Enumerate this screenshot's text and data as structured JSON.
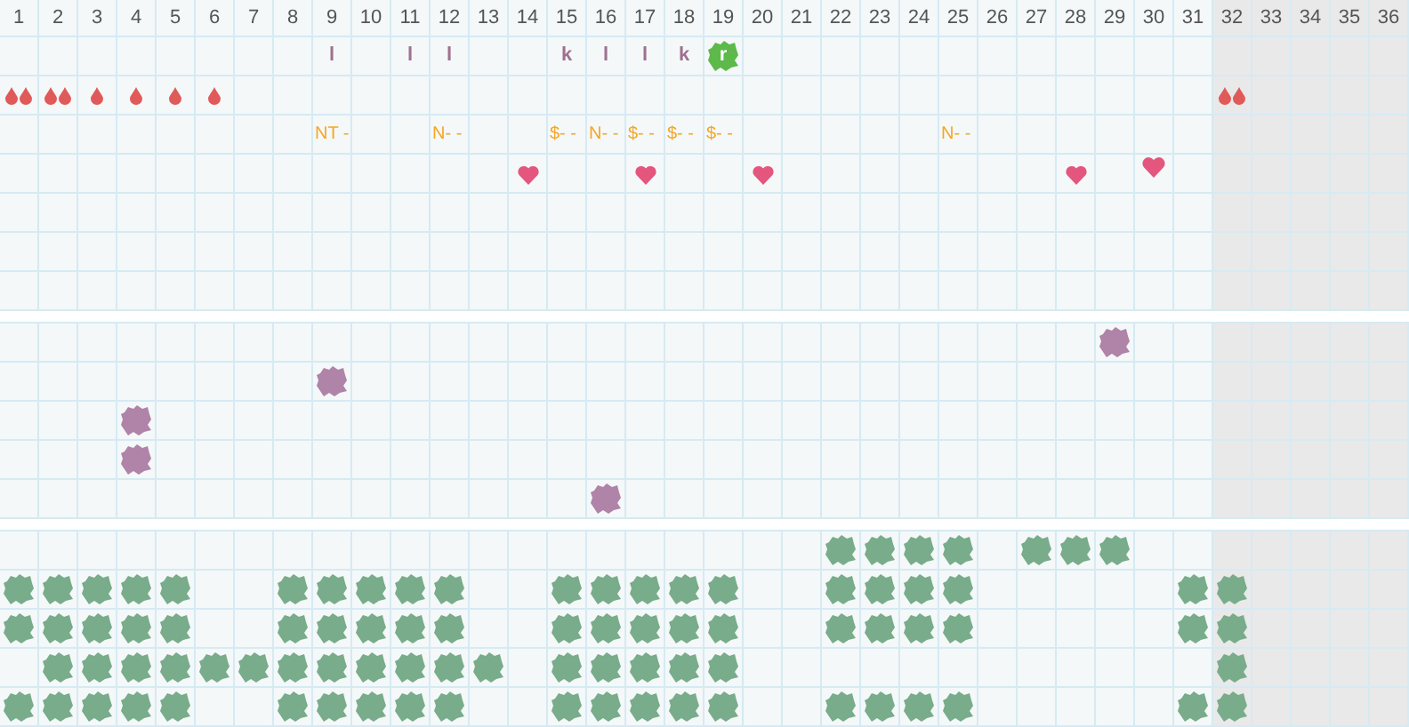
{
  "columns": [
    {
      "label": "1",
      "shaded": false
    },
    {
      "label": "2",
      "shaded": false
    },
    {
      "label": "3",
      "shaded": false
    },
    {
      "label": "4",
      "shaded": false
    },
    {
      "label": "5",
      "shaded": false
    },
    {
      "label": "6",
      "shaded": false
    },
    {
      "label": "7",
      "shaded": false
    },
    {
      "label": "8",
      "shaded": false
    },
    {
      "label": "9",
      "shaded": false
    },
    {
      "label": "10",
      "shaded": false
    },
    {
      "label": "11",
      "shaded": false
    },
    {
      "label": "12",
      "shaded": false
    },
    {
      "label": "13",
      "shaded": false
    },
    {
      "label": "14",
      "shaded": false
    },
    {
      "label": "15",
      "shaded": false
    },
    {
      "label": "16",
      "shaded": false
    },
    {
      "label": "17",
      "shaded": false
    },
    {
      "label": "18",
      "shaded": false
    },
    {
      "label": "19",
      "shaded": false
    },
    {
      "label": "20",
      "shaded": false
    },
    {
      "label": "21",
      "shaded": false
    },
    {
      "label": "22",
      "shaded": false
    },
    {
      "label": "23",
      "shaded": false
    },
    {
      "label": "24",
      "shaded": false
    },
    {
      "label": "25",
      "shaded": false
    },
    {
      "label": "26",
      "shaded": false
    },
    {
      "label": "27",
      "shaded": false
    },
    {
      "label": "28",
      "shaded": false
    },
    {
      "label": "29",
      "shaded": false
    },
    {
      "label": "30",
      "shaded": false
    },
    {
      "label": "31",
      "shaded": false
    },
    {
      "label": "32",
      "shaded": true
    },
    {
      "label": "33",
      "shaded": true
    },
    {
      "label": "34",
      "shaded": true
    },
    {
      "label": "35",
      "shaded": true
    },
    {
      "label": "36",
      "shaded": true
    }
  ],
  "sections": [
    {
      "rows": [
        [
          null,
          null,
          null,
          null,
          null,
          null,
          null,
          null,
          {
            "kind": "letter",
            "text": "l",
            "highlighted": false
          },
          null,
          {
            "kind": "letter",
            "text": "l",
            "highlighted": false
          },
          {
            "kind": "letter",
            "text": "l",
            "highlighted": false
          },
          null,
          null,
          {
            "kind": "letter",
            "text": "k",
            "highlighted": false
          },
          {
            "kind": "letter",
            "text": "l",
            "highlighted": false
          },
          {
            "kind": "letter",
            "text": "l",
            "highlighted": false
          },
          {
            "kind": "letter",
            "text": "k",
            "highlighted": false
          },
          {
            "kind": "letter",
            "text": "r",
            "highlighted": true
          },
          null,
          null,
          null,
          null,
          null,
          null,
          null,
          null,
          null,
          null,
          null,
          null,
          null,
          null,
          null,
          null,
          null
        ],
        [
          {
            "kind": "drop-pair"
          },
          {
            "kind": "drop-pair"
          },
          {
            "kind": "drop"
          },
          {
            "kind": "drop"
          },
          {
            "kind": "drop"
          },
          {
            "kind": "drop"
          },
          null,
          null,
          null,
          null,
          null,
          null,
          null,
          null,
          null,
          null,
          null,
          null,
          null,
          null,
          null,
          null,
          null,
          null,
          null,
          null,
          null,
          null,
          null,
          null,
          null,
          {
            "kind": "drop-pair"
          },
          null,
          null,
          null,
          null
        ],
        [
          null,
          null,
          null,
          null,
          null,
          null,
          null,
          null,
          {
            "kind": "label",
            "text": "NT -"
          },
          null,
          null,
          {
            "kind": "label",
            "text": "N- -"
          },
          null,
          null,
          {
            "kind": "label",
            "text": "$- -"
          },
          {
            "kind": "label",
            "text": "N- -"
          },
          {
            "kind": "label",
            "text": "$- -"
          },
          {
            "kind": "label",
            "text": "$- -"
          },
          {
            "kind": "label",
            "text": "$- -"
          },
          null,
          null,
          null,
          null,
          null,
          {
            "kind": "label",
            "text": "N- -"
          },
          null,
          null,
          null,
          null,
          null,
          null,
          null,
          null,
          null,
          null,
          null
        ],
        [
          null,
          null,
          null,
          null,
          null,
          null,
          null,
          null,
          null,
          null,
          null,
          null,
          null,
          {
            "kind": "heart",
            "raised": false
          },
          null,
          null,
          {
            "kind": "heart",
            "raised": false
          },
          null,
          null,
          {
            "kind": "heart",
            "raised": false
          },
          null,
          null,
          null,
          null,
          null,
          null,
          null,
          {
            "kind": "heart",
            "raised": false
          },
          null,
          {
            "kind": "heart",
            "raised": true
          },
          null,
          null,
          null,
          null,
          null,
          null
        ],
        [
          null,
          null,
          null,
          null,
          null,
          null,
          null,
          null,
          null,
          null,
          null,
          null,
          null,
          null,
          null,
          null,
          null,
          null,
          null,
          null,
          null,
          null,
          null,
          null,
          null,
          null,
          null,
          null,
          null,
          null,
          null,
          null,
          null,
          null,
          null,
          null
        ],
        [
          null,
          null,
          null,
          null,
          null,
          null,
          null,
          null,
          null,
          null,
          null,
          null,
          null,
          null,
          null,
          null,
          null,
          null,
          null,
          null,
          null,
          null,
          null,
          null,
          null,
          null,
          null,
          null,
          null,
          null,
          null,
          null,
          null,
          null,
          null,
          null
        ],
        [
          null,
          null,
          null,
          null,
          null,
          null,
          null,
          null,
          null,
          null,
          null,
          null,
          null,
          null,
          null,
          null,
          null,
          null,
          null,
          null,
          null,
          null,
          null,
          null,
          null,
          null,
          null,
          null,
          null,
          null,
          null,
          null,
          null,
          null,
          null,
          null
        ]
      ]
    },
    {
      "rows": [
        [
          null,
          null,
          null,
          null,
          null,
          null,
          null,
          null,
          null,
          null,
          null,
          null,
          null,
          null,
          null,
          null,
          null,
          null,
          null,
          null,
          null,
          null,
          null,
          null,
          null,
          null,
          null,
          null,
          {
            "kind": "blob",
            "color": "#b083a8"
          },
          null,
          null,
          null,
          null,
          null,
          null,
          null
        ],
        [
          null,
          null,
          null,
          null,
          null,
          null,
          null,
          null,
          {
            "kind": "blob",
            "color": "#b083a8"
          },
          null,
          null,
          null,
          null,
          null,
          null,
          null,
          null,
          null,
          null,
          null,
          null,
          null,
          null,
          null,
          null,
          null,
          null,
          null,
          null,
          null,
          null,
          null,
          null,
          null,
          null,
          null
        ],
        [
          null,
          null,
          null,
          {
            "kind": "blob",
            "color": "#b083a8"
          },
          null,
          null,
          null,
          null,
          null,
          null,
          null,
          null,
          null,
          null,
          null,
          null,
          null,
          null,
          null,
          null,
          null,
          null,
          null,
          null,
          null,
          null,
          null,
          null,
          null,
          null,
          null,
          null,
          null,
          null,
          null,
          null
        ],
        [
          null,
          null,
          null,
          {
            "kind": "blob",
            "color": "#b083a8"
          },
          null,
          null,
          null,
          null,
          null,
          null,
          null,
          null,
          null,
          null,
          null,
          null,
          null,
          null,
          null,
          null,
          null,
          null,
          null,
          null,
          null,
          null,
          null,
          null,
          null,
          null,
          null,
          null,
          null,
          null,
          null,
          null
        ],
        [
          null,
          null,
          null,
          null,
          null,
          null,
          null,
          null,
          null,
          null,
          null,
          null,
          null,
          null,
          null,
          {
            "kind": "blob",
            "color": "#b083a8"
          },
          null,
          null,
          null,
          null,
          null,
          null,
          null,
          null,
          null,
          null,
          null,
          null,
          null,
          null,
          null,
          null,
          null,
          null,
          null,
          null
        ]
      ]
    },
    {
      "rows": [
        [
          null,
          null,
          null,
          null,
          null,
          null,
          null,
          null,
          null,
          null,
          null,
          null,
          null,
          null,
          null,
          null,
          null,
          null,
          null,
          null,
          null,
          {
            "kind": "blob",
            "color": "#78ac8a"
          },
          {
            "kind": "blob",
            "color": "#78ac8a"
          },
          {
            "kind": "blob",
            "color": "#78ac8a"
          },
          {
            "kind": "blob",
            "color": "#78ac8a"
          },
          null,
          {
            "kind": "blob",
            "color": "#78ac8a"
          },
          {
            "kind": "blob",
            "color": "#78ac8a"
          },
          {
            "kind": "blob",
            "color": "#78ac8a"
          },
          null,
          null,
          null,
          null,
          null,
          null,
          null
        ],
        [
          {
            "kind": "blob",
            "color": "#78ac8a"
          },
          {
            "kind": "blob",
            "color": "#78ac8a"
          },
          {
            "kind": "blob",
            "color": "#78ac8a"
          },
          {
            "kind": "blob",
            "color": "#78ac8a"
          },
          {
            "kind": "blob",
            "color": "#78ac8a"
          },
          null,
          null,
          {
            "kind": "blob",
            "color": "#78ac8a"
          },
          {
            "kind": "blob",
            "color": "#78ac8a"
          },
          {
            "kind": "blob",
            "color": "#78ac8a"
          },
          {
            "kind": "blob",
            "color": "#78ac8a"
          },
          {
            "kind": "blob",
            "color": "#78ac8a"
          },
          null,
          null,
          {
            "kind": "blob",
            "color": "#78ac8a"
          },
          {
            "kind": "blob",
            "color": "#78ac8a"
          },
          {
            "kind": "blob",
            "color": "#78ac8a"
          },
          {
            "kind": "blob",
            "color": "#78ac8a"
          },
          {
            "kind": "blob",
            "color": "#78ac8a"
          },
          null,
          null,
          {
            "kind": "blob",
            "color": "#78ac8a"
          },
          {
            "kind": "blob",
            "color": "#78ac8a"
          },
          {
            "kind": "blob",
            "color": "#78ac8a"
          },
          {
            "kind": "blob",
            "color": "#78ac8a"
          },
          null,
          null,
          null,
          null,
          null,
          {
            "kind": "blob",
            "color": "#78ac8a"
          },
          {
            "kind": "blob",
            "color": "#78ac8a"
          },
          null,
          null,
          null,
          null
        ],
        [
          {
            "kind": "blob",
            "color": "#78ac8a"
          },
          {
            "kind": "blob",
            "color": "#78ac8a"
          },
          {
            "kind": "blob",
            "color": "#78ac8a"
          },
          {
            "kind": "blob",
            "color": "#78ac8a"
          },
          {
            "kind": "blob",
            "color": "#78ac8a"
          },
          null,
          null,
          {
            "kind": "blob",
            "color": "#78ac8a"
          },
          {
            "kind": "blob",
            "color": "#78ac8a"
          },
          {
            "kind": "blob",
            "color": "#78ac8a"
          },
          {
            "kind": "blob",
            "color": "#78ac8a"
          },
          {
            "kind": "blob",
            "color": "#78ac8a"
          },
          null,
          null,
          {
            "kind": "blob",
            "color": "#78ac8a"
          },
          {
            "kind": "blob",
            "color": "#78ac8a"
          },
          {
            "kind": "blob",
            "color": "#78ac8a"
          },
          {
            "kind": "blob",
            "color": "#78ac8a"
          },
          {
            "kind": "blob",
            "color": "#78ac8a"
          },
          null,
          null,
          {
            "kind": "blob",
            "color": "#78ac8a"
          },
          {
            "kind": "blob",
            "color": "#78ac8a"
          },
          {
            "kind": "blob",
            "color": "#78ac8a"
          },
          {
            "kind": "blob",
            "color": "#78ac8a"
          },
          null,
          null,
          null,
          null,
          null,
          {
            "kind": "blob",
            "color": "#78ac8a"
          },
          {
            "kind": "blob",
            "color": "#78ac8a"
          },
          null,
          null,
          null,
          null
        ],
        [
          null,
          {
            "kind": "blob",
            "color": "#78ac8a"
          },
          {
            "kind": "blob",
            "color": "#78ac8a"
          },
          {
            "kind": "blob",
            "color": "#78ac8a"
          },
          {
            "kind": "blob",
            "color": "#78ac8a"
          },
          {
            "kind": "blob",
            "color": "#78ac8a"
          },
          {
            "kind": "blob",
            "color": "#78ac8a"
          },
          {
            "kind": "blob",
            "color": "#78ac8a"
          },
          {
            "kind": "blob",
            "color": "#78ac8a"
          },
          {
            "kind": "blob",
            "color": "#78ac8a"
          },
          {
            "kind": "blob",
            "color": "#78ac8a"
          },
          {
            "kind": "blob",
            "color": "#78ac8a"
          },
          {
            "kind": "blob",
            "color": "#78ac8a"
          },
          null,
          {
            "kind": "blob",
            "color": "#78ac8a"
          },
          {
            "kind": "blob",
            "color": "#78ac8a"
          },
          {
            "kind": "blob",
            "color": "#78ac8a"
          },
          {
            "kind": "blob",
            "color": "#78ac8a"
          },
          {
            "kind": "blob",
            "color": "#78ac8a"
          },
          null,
          null,
          null,
          null,
          null,
          null,
          null,
          null,
          null,
          null,
          null,
          null,
          {
            "kind": "blob",
            "color": "#78ac8a"
          },
          null,
          null,
          null,
          null
        ],
        [
          {
            "kind": "blob",
            "color": "#78ac8a"
          },
          {
            "kind": "blob",
            "color": "#78ac8a"
          },
          {
            "kind": "blob",
            "color": "#78ac8a"
          },
          {
            "kind": "blob",
            "color": "#78ac8a"
          },
          {
            "kind": "blob",
            "color": "#78ac8a"
          },
          null,
          null,
          {
            "kind": "blob",
            "color": "#78ac8a"
          },
          {
            "kind": "blob",
            "color": "#78ac8a"
          },
          {
            "kind": "blob",
            "color": "#78ac8a"
          },
          {
            "kind": "blob",
            "color": "#78ac8a"
          },
          {
            "kind": "blob",
            "color": "#78ac8a"
          },
          null,
          null,
          {
            "kind": "blob",
            "color": "#78ac8a"
          },
          {
            "kind": "blob",
            "color": "#78ac8a"
          },
          {
            "kind": "blob",
            "color": "#78ac8a"
          },
          {
            "kind": "blob",
            "color": "#78ac8a"
          },
          {
            "kind": "blob",
            "color": "#78ac8a"
          },
          null,
          null,
          {
            "kind": "blob",
            "color": "#78ac8a"
          },
          {
            "kind": "blob",
            "color": "#78ac8a"
          },
          {
            "kind": "blob",
            "color": "#78ac8a"
          },
          {
            "kind": "blob",
            "color": "#78ac8a"
          },
          null,
          null,
          null,
          null,
          null,
          {
            "kind": "blob",
            "color": "#78ac8a"
          },
          {
            "kind": "blob",
            "color": "#78ac8a"
          },
          null,
          null,
          null,
          null
        ]
      ]
    }
  ]
}
